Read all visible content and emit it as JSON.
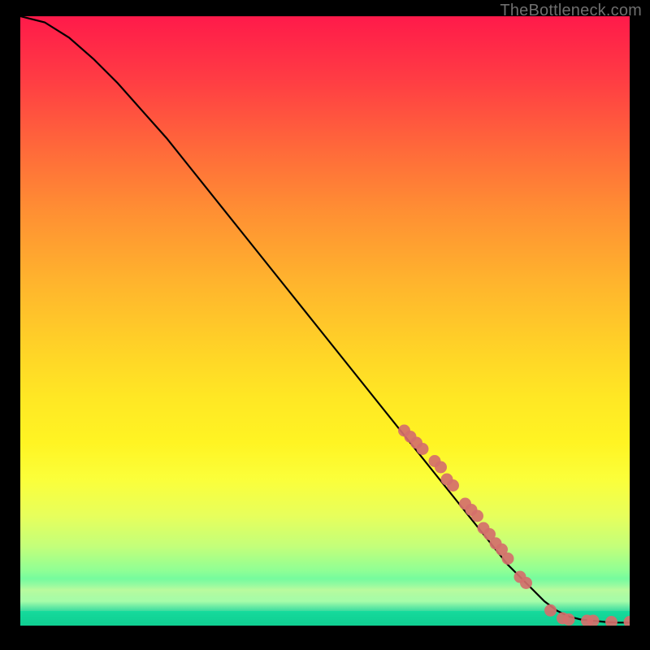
{
  "attribution": "TheBottleneck.com",
  "colors": {
    "curve": "#000000",
    "marker": "#d46f6b",
    "bg_black": "#000000"
  },
  "chart_data": {
    "type": "line",
    "title": "",
    "xlabel": "",
    "ylabel": "",
    "xlim": [
      0,
      100
    ],
    "ylim": [
      0,
      100
    ],
    "series": [
      {
        "name": "curve",
        "x": [
          0,
          4,
          8,
          12,
          16,
          20,
          24,
          28,
          32,
          36,
          40,
          44,
          48,
          52,
          56,
          60,
          64,
          68,
          72,
          76,
          80,
          82,
          84,
          86,
          88,
          90,
          92,
          94,
          96,
          98,
          100
        ],
        "y": [
          100,
          99,
          96.5,
          93,
          89,
          84.5,
          80,
          75,
          70,
          65,
          60,
          55,
          50,
          45,
          40,
          35,
          30,
          25,
          20,
          15,
          10,
          8,
          6,
          4,
          2.5,
          1.5,
          1,
          0.8,
          0.6,
          0.5,
          0.5
        ]
      }
    ],
    "markers": [
      {
        "x": 63,
        "y": 32
      },
      {
        "x": 64,
        "y": 31
      },
      {
        "x": 65,
        "y": 30
      },
      {
        "x": 66,
        "y": 29
      },
      {
        "x": 68,
        "y": 27
      },
      {
        "x": 69,
        "y": 26
      },
      {
        "x": 70,
        "y": 24
      },
      {
        "x": 71,
        "y": 23
      },
      {
        "x": 73,
        "y": 20
      },
      {
        "x": 74,
        "y": 19
      },
      {
        "x": 75,
        "y": 18
      },
      {
        "x": 76,
        "y": 16
      },
      {
        "x": 77,
        "y": 15
      },
      {
        "x": 78,
        "y": 13.5
      },
      {
        "x": 79,
        "y": 12.5
      },
      {
        "x": 80,
        "y": 11
      },
      {
        "x": 82,
        "y": 8
      },
      {
        "x": 83,
        "y": 7
      },
      {
        "x": 87,
        "y": 2.5
      },
      {
        "x": 89,
        "y": 1.2
      },
      {
        "x": 90,
        "y": 1
      },
      {
        "x": 93,
        "y": 0.8
      },
      {
        "x": 94,
        "y": 0.8
      },
      {
        "x": 97,
        "y": 0.6
      },
      {
        "x": 100,
        "y": 0.6
      }
    ]
  }
}
